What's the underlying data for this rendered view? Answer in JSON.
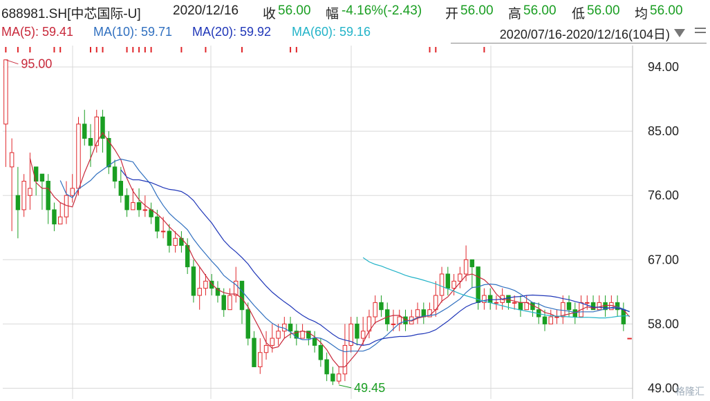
{
  "header": {
    "symbol": "688981.SH[中芯国际-U]",
    "date": "2020/12/16",
    "close_label": "收",
    "close_value": "56.00",
    "change_label": "幅",
    "change_value": "-4.16%(-2.43)",
    "open_label": "开",
    "open_value": "56.00",
    "high_label": "高",
    "high_value": "56.00",
    "low_label": "低",
    "low_value": "56.00",
    "avg_label": "均",
    "avg_value": "56.00"
  },
  "ma_legend": {
    "ma5": "MA(5): 59.41",
    "ma10": "MA(10): 59.71",
    "ma20": "MA(20): 59.92",
    "ma60": "MA(60): 59.16"
  },
  "range": {
    "text": "2020/07/16-2020/12/16(104日)"
  },
  "colors": {
    "up": "#e0262a",
    "down": "#1a9e22",
    "ma5": "#c8283a",
    "ma10": "#2f6fbf",
    "ma20": "#1f36b8",
    "ma60": "#22b3c8",
    "grid": "#d8d8d8",
    "header_green": "#1a9e22",
    "ma5_text": "#c8283a",
    "ma10_text": "#2f6fbf",
    "ma20_text": "#1f36b8",
    "ma60_text": "#22b3c8"
  },
  "watermark": "格隆汇",
  "chart_data": {
    "type": "candlestick",
    "y_ticks": [
      "94.00",
      "85.00",
      "76.00",
      "67.00",
      "58.00",
      "49.00"
    ],
    "ylim": [
      47.5,
      97.0
    ],
    "annotations": [
      {
        "text": "95.00",
        "index": 0,
        "value": 95.0
      },
      {
        "text": "49.45",
        "index": 55,
        "value": 49.45
      }
    ],
    "candles": [
      [
        86,
        95,
        95,
        80
      ],
      [
        80,
        82,
        84,
        71
      ],
      [
        76,
        74,
        80,
        70
      ],
      [
        74,
        78,
        79,
        73
      ],
      [
        76,
        77,
        82,
        74
      ],
      [
        80,
        78,
        80,
        76
      ],
      [
        79,
        78,
        79,
        74
      ],
      [
        78,
        74,
        79,
        72
      ],
      [
        74,
        72,
        75,
        71
      ],
      [
        72,
        73,
        75,
        72
      ],
      [
        73,
        76,
        78,
        72
      ],
      [
        76,
        77,
        79,
        75
      ],
      [
        77,
        86,
        87,
        76
      ],
      [
        86,
        84,
        88,
        83
      ],
      [
        84,
        83,
        86,
        80
      ],
      [
        83,
        87,
        88,
        82
      ],
      [
        87,
        84,
        88,
        82
      ],
      [
        84,
        80,
        85,
        79
      ],
      [
        80,
        78,
        81,
        77
      ],
      [
        78,
        76,
        80,
        75
      ],
      [
        76,
        74,
        77,
        73
      ],
      [
        74,
        75,
        77,
        74
      ],
      [
        75,
        74,
        77,
        73
      ],
      [
        74,
        74,
        76,
        73
      ],
      [
        74,
        73,
        75,
        72
      ],
      [
        73,
        71,
        74,
        70
      ],
      [
        71,
        71,
        73,
        70
      ],
      [
        71,
        69,
        72,
        68
      ],
      [
        69,
        70,
        71,
        68
      ],
      [
        70,
        69,
        71,
        68
      ],
      [
        69,
        66,
        70,
        65
      ],
      [
        66,
        62,
        67,
        61
      ],
      [
        62,
        63,
        66,
        60
      ],
      [
        63,
        64,
        65,
        62
      ],
      [
        64,
        63,
        65,
        62
      ],
      [
        63,
        62,
        64,
        61
      ],
      [
        62,
        60,
        63,
        59
      ],
      [
        60,
        62,
        63,
        60
      ],
      [
        62,
        64,
        66,
        61
      ],
      [
        64,
        60,
        64,
        58
      ],
      [
        60,
        56,
        61,
        55
      ],
      [
        56,
        52,
        57,
        52
      ],
      [
        52,
        54,
        56,
        51
      ],
      [
        54,
        55,
        57,
        53
      ],
      [
        55,
        56,
        58,
        54
      ],
      [
        56,
        57,
        58,
        55
      ],
      [
        57,
        58,
        59,
        56
      ],
      [
        58,
        57,
        59,
        56
      ],
      [
        57,
        56,
        58,
        55
      ],
      [
        56,
        57,
        58,
        56
      ],
      [
        57,
        56,
        57,
        55
      ],
      [
        56,
        55,
        57,
        54
      ],
      [
        55,
        53,
        56,
        52
      ],
      [
        53,
        51,
        54,
        50
      ],
      [
        51,
        50,
        52,
        49.45
      ],
      [
        50,
        51,
        52,
        49.6
      ],
      [
        51,
        55,
        58,
        50
      ],
      [
        55,
        58,
        59,
        54
      ],
      [
        58,
        56,
        59,
        55
      ],
      [
        56,
        57,
        59,
        55
      ],
      [
        57,
        59,
        60,
        56
      ],
      [
        59,
        61,
        62,
        58
      ],
      [
        61,
        60,
        62,
        59
      ],
      [
        60,
        58,
        61,
        57
      ],
      [
        58,
        58,
        60,
        57
      ],
      [
        58,
        59,
        60,
        57
      ],
      [
        59,
        58,
        60,
        57
      ],
      [
        58,
        59,
        60,
        58
      ],
      [
        59,
        60,
        61,
        58
      ],
      [
        60,
        59,
        61,
        58
      ],
      [
        59,
        60,
        61,
        59
      ],
      [
        60,
        62,
        64,
        59
      ],
      [
        62,
        65,
        66,
        61
      ],
      [
        65,
        63,
        66,
        62
      ],
      [
        63,
        64,
        65,
        62
      ],
      [
        64,
        65,
        66,
        63
      ],
      [
        65,
        67,
        69,
        64
      ],
      [
        67,
        66,
        67,
        63
      ],
      [
        66,
        61,
        66,
        60
      ],
      [
        61,
        62,
        63,
        60
      ],
      [
        62,
        61,
        63,
        60
      ],
      [
        61,
        61,
        62,
        60
      ],
      [
        61,
        62,
        63,
        60
      ],
      [
        62,
        61,
        62,
        60
      ],
      [
        61,
        61,
        62,
        60
      ],
      [
        61,
        60,
        62,
        59
      ],
      [
        60,
        61,
        62,
        60
      ],
      [
        61,
        60,
        61,
        59
      ],
      [
        60,
        59,
        61,
        58
      ],
      [
        59,
        58,
        60,
        57
      ],
      [
        58,
        59,
        60,
        58
      ],
      [
        59,
        59,
        60,
        58
      ],
      [
        59,
        61,
        62,
        58
      ],
      [
        61,
        60,
        62,
        59
      ],
      [
        60,
        59,
        61,
        58
      ],
      [
        59,
        61,
        62,
        59
      ],
      [
        61,
        61,
        62,
        60
      ],
      [
        61,
        60,
        62,
        60
      ],
      [
        60,
        61,
        62,
        60
      ],
      [
        61,
        60,
        62,
        59
      ],
      [
        60,
        61,
        62,
        60
      ],
      [
        61,
        60,
        62,
        59
      ],
      [
        60,
        58,
        61,
        57
      ],
      [
        56,
        56,
        56,
        56
      ]
    ]
  }
}
